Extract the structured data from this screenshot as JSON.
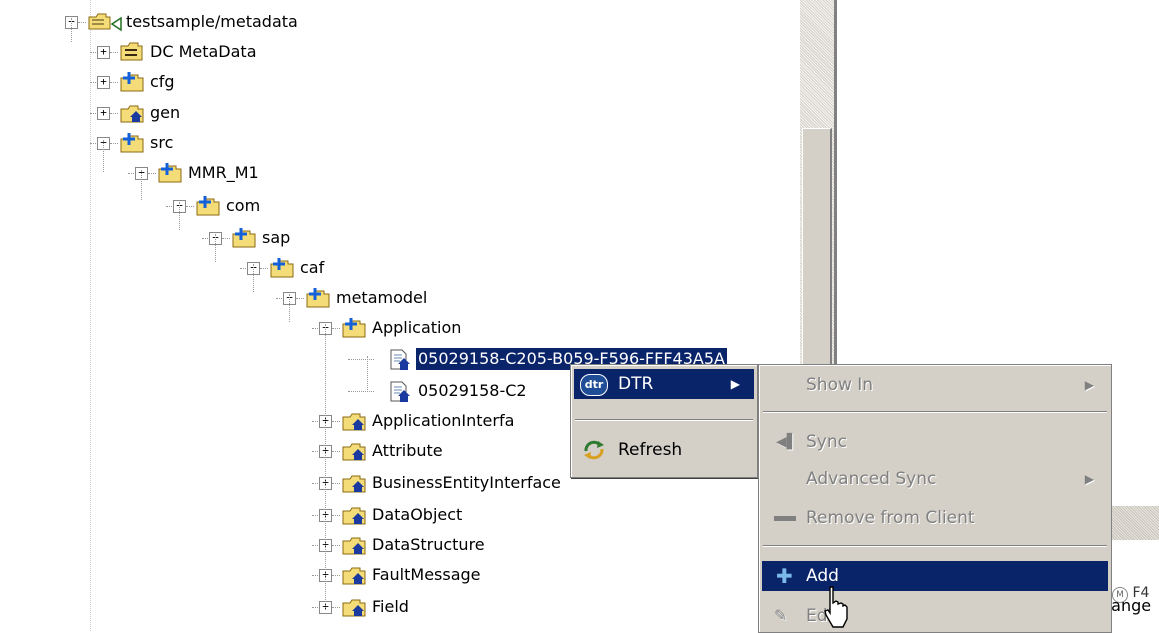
{
  "tree": {
    "nodes": [
      {
        "label": "testsample/metadata",
        "toggle": "−",
        "icon": "project-icon"
      },
      {
        "label": "DC MetaData",
        "toggle": "+",
        "icon": "dc-metadata-icon"
      },
      {
        "label": "cfg",
        "toggle": "+",
        "icon": "folder-plus-icon"
      },
      {
        "label": "gen",
        "toggle": "+",
        "icon": "folder-home-icon"
      },
      {
        "label": "src",
        "toggle": "−",
        "icon": "folder-plus-icon"
      },
      {
        "label": "MMR_M1",
        "toggle": "−",
        "icon": "folder-plus-icon"
      },
      {
        "label": "com",
        "toggle": "−",
        "icon": "folder-plus-icon"
      },
      {
        "label": "sap",
        "toggle": "−",
        "icon": "folder-plus-icon"
      },
      {
        "label": "caf",
        "toggle": "−",
        "icon": "folder-plus-icon"
      },
      {
        "label": "metamodel",
        "toggle": "−",
        "icon": "folder-plus-icon"
      },
      {
        "label": "Application",
        "toggle": "−",
        "icon": "folder-plus-icon"
      },
      {
        "label": "05029158-C205-B059-F596-FFF43A5A",
        "toggle": "",
        "icon": "file-home-icon",
        "selected": true
      },
      {
        "label": "05029158-C2",
        "toggle": "",
        "icon": "file-home-icon"
      },
      {
        "label": "ApplicationInterfa",
        "toggle": "+",
        "icon": "folder-home-icon"
      },
      {
        "label": "Attribute",
        "toggle": "+",
        "icon": "folder-home-icon"
      },
      {
        "label": "BusinessEntityInterface",
        "toggle": "+",
        "icon": "folder-home-icon"
      },
      {
        "label": "DataObject",
        "toggle": "+",
        "icon": "folder-home-icon"
      },
      {
        "label": "DataStructure",
        "toggle": "+",
        "icon": "folder-home-icon"
      },
      {
        "label": "FaultMessage",
        "toggle": "+",
        "icon": "folder-home-icon"
      },
      {
        "label": "Field",
        "toggle": "+",
        "icon": "folder-home-icon"
      }
    ]
  },
  "context_menu": {
    "dtr_label": "DTR",
    "dtr_icon_text": "dtr",
    "refresh_label": "Refresh"
  },
  "submenu": {
    "show_in": "Show In",
    "sync": "Sync",
    "advanced_sync": "Advanced Sync",
    "remove_from_client": "Remove from Client",
    "add": "Add",
    "edit": "Edit"
  },
  "background_pane": {
    "badge": "M",
    "label_top": "F4",
    "label_bottom": "hange"
  },
  "colors": {
    "selection": "#0a246a",
    "menu_bg": "#d4d0c8",
    "folder": "#f4dc78",
    "plus_blue": "#1460d8"
  }
}
